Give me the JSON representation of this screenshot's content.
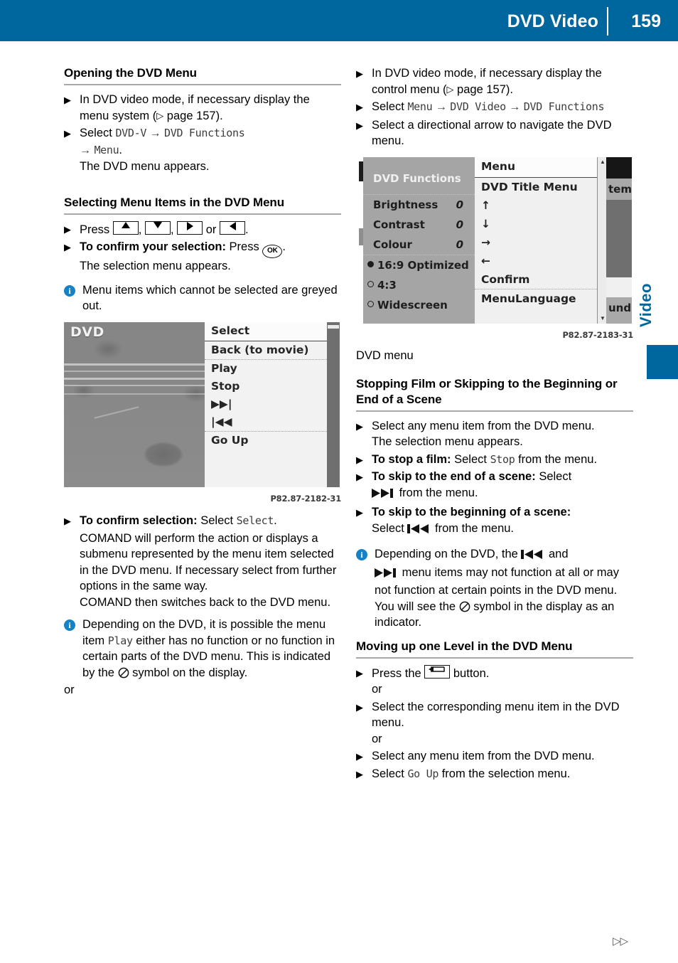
{
  "header": {
    "title": "DVD Video",
    "page_number": "159"
  },
  "side_tab": {
    "label": "Video"
  },
  "footer": {
    "marker": "▷▷"
  },
  "left_column": {
    "section1_title": "Opening the DVD Menu",
    "s1_step1_a": "In DVD video mode, if necessary display the menu system (",
    "s1_step1_pg": " page 157).",
    "s1_step2_select": "Select ",
    "s1_step2_code1": "DVD-V",
    "s1_step2_code2": "DVD Functions",
    "s1_step2_code3": "Menu",
    "s1_step2_period": ".",
    "s1_step2_result": "The DVD menu appears.",
    "section2_title": "Selecting Menu Items in the DVD Menu",
    "s2_step1_press": "Press ",
    "s2_step1_comma1": ",",
    "s2_step1_comma2": ",",
    "s2_step1_or": "or",
    "s2_step1_period": ".",
    "s2_step2_bold": "To confirm your selection:",
    "s2_step2_text": " Press ",
    "s2_step2_ok": "OK",
    "s2_step2_period": ".",
    "s2_step2_result": "The selection menu appears.",
    "note1": "Menu items which cannot be selected are greyed out.",
    "fig1_code": "P82.87-2182-31",
    "s3_step1_bold": "To confirm selection:",
    "s3_step1_text": " Select ",
    "s3_step1_code": "Select",
    "s3_step1_period": ".",
    "s3_para1": "COMAND will perform the action or displays a submenu represented by the menu item selected in the DVD menu. If necessary select from further options in the same way.",
    "s3_para2": "COMAND then switches back to the DVD menu.",
    "note2_pre": "Depending on the DVD, it is possible the menu item ",
    "note2_code": "Play",
    "note2_mid": " either has no function or no function in certain parts of the DVD menu. This is indicated by the ",
    "note2_post": " symbol on the display.",
    "or_text": "or"
  },
  "right_column": {
    "s1_step1_a": "In DVD video mode, if necessary display the control menu (",
    "s1_step1_pg": " page 157).",
    "s1_step2_select": "Select ",
    "s1_step2_code1": "Menu",
    "s1_step2_code2": "DVD Video",
    "s1_step2_code3": "DVD Functions",
    "s1_step3": "Select a directional arrow to navigate the DVD menu.",
    "fig2_code": "P82.87-2183-31",
    "fig2_label": "DVD menu",
    "section2_title": "Stopping Film or Skipping to the Beginning or End of a Scene",
    "s2_step1": "Select any menu item from the DVD menu.",
    "s2_step1_result": "The selection menu appears.",
    "s2_step2_bold": "To stop a film:",
    "s2_step2_pre": " Select ",
    "s2_step2_code": "Stop",
    "s2_step2_post": " from the menu.",
    "s2_step3_bold": "To skip to the end of a scene:",
    "s2_step3_pre": " Select",
    "s2_step3_post": " from the menu.",
    "s2_step4_bold": "To skip to the beginning of a scene:",
    "s2_step4_pre": "Select",
    "s2_step4_post": " from the menu.",
    "note1_pre": "Depending on the DVD, the ",
    "note1_mid1": " and",
    "note1_mid2": " menu items may not function at all or may not function at certain points in the DVD menu. You will see the ",
    "note1_post": " symbol in the display as an indicator.",
    "section3_title": "Moving up one Level in the DVD Menu",
    "s3_step1_pre": "Press the ",
    "s3_step1_post": " button.",
    "or1": "or",
    "s3_step2": "Select the corresponding menu item in the DVD menu.",
    "or2": "or",
    "s3_step3": "Select any menu item from the DVD menu.",
    "s3_step4_pre": "Select ",
    "s3_step4_code": "Go Up",
    "s3_step4_post": " from the selection menu."
  },
  "figure1": {
    "dvd_logo": "DVD",
    "menu_items": [
      "Select",
      "Back (to movie)",
      "Play",
      "Stop",
      "▶▶|",
      "|◀◀",
      "Go Up"
    ]
  },
  "figure2": {
    "functions_header": "DVD Functions",
    "rows": [
      {
        "label": "Brightness",
        "value": "0"
      },
      {
        "label": "Contrast",
        "value": "0"
      },
      {
        "label": "Colour",
        "value": "0"
      }
    ],
    "aspect_options": [
      {
        "label": "16:9 Optimized",
        "selected": true
      },
      {
        "label": "4:3",
        "selected": false
      },
      {
        "label": "Widescreen",
        "selected": false
      }
    ],
    "menu_items": [
      "Menu",
      "DVD Title Menu",
      "↑",
      "↓",
      "→",
      "←",
      "Confirm",
      "MenuLanguage"
    ],
    "right_fragments": {
      "item": "tem",
      "und": "und"
    }
  },
  "colors": {
    "brand_blue": "#00669e",
    "info_blue": "#1482c4",
    "rule_grey": "#a8a8a8",
    "code_grey": "#3c3c3c"
  }
}
